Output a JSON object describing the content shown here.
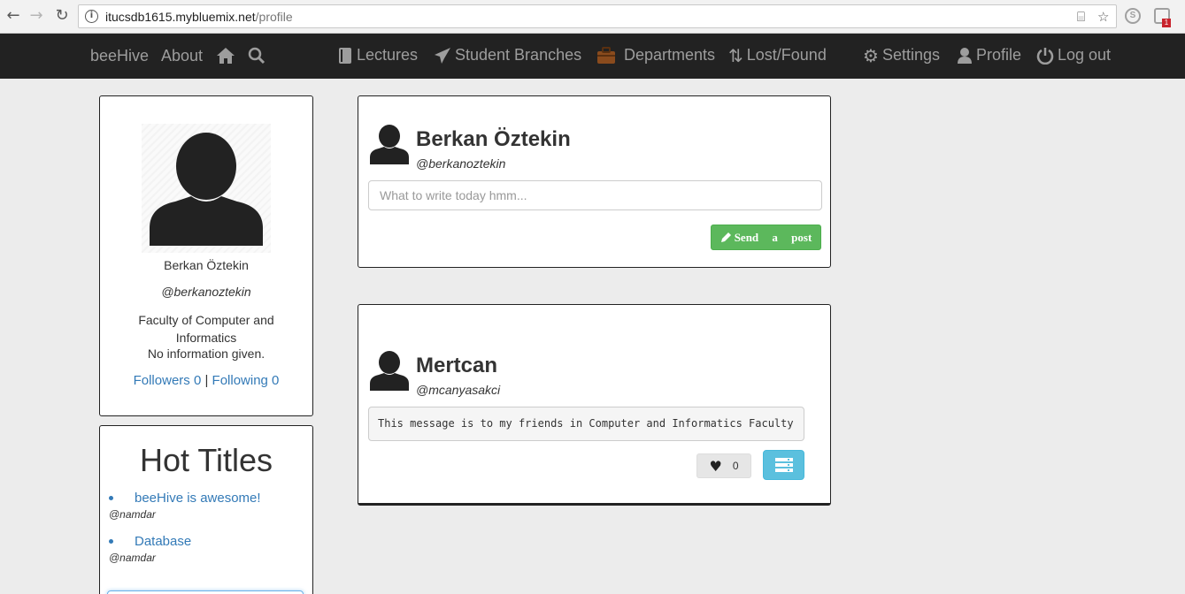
{
  "browser": {
    "url_host": "itucsdb1615.mybluemix.net",
    "url_path": "/profile",
    "extension_badge": "1"
  },
  "navbar": {
    "brand": "beeHive",
    "about": "About",
    "lectures": "Lectures",
    "student_branches": "Student Branches",
    "departments": "Departments",
    "lost_found": "Lost/Found",
    "settings": "Settings",
    "profile": "Profile",
    "logout": "Log out"
  },
  "profile_card": {
    "name": "Berkan Öztekin",
    "handle": "@berkanoztekin",
    "faculty": "Faculty of Computer and Informatics",
    "info": "No information given.",
    "followers_label": "Followers 0",
    "separator": " | ",
    "following_label": "Following 0"
  },
  "hot_titles": {
    "heading": "Hot Titles",
    "items": [
      {
        "title": "beeHive is awesome!",
        "user": "@namdar"
      },
      {
        "title": "Database",
        "user": "@namdar"
      }
    ]
  },
  "compose": {
    "name": "Berkan Öztekin",
    "handle": "@berkanoztekin",
    "placeholder": "What to write today hmm...",
    "send_label": "Send a post"
  },
  "post": {
    "name": "Mertcan",
    "handle": "@mcanyasakci",
    "message": "This message is to my friends in Computer and Informatics Faculty",
    "likes": "0"
  },
  "colors": {
    "navbar_bg": "#222222",
    "link": "#337ab7",
    "send_button": "#5cb85c",
    "list_button": "#5bc0de"
  },
  "icons": [
    "back-arrow-icon",
    "forward-arrow-icon",
    "reload-icon",
    "info-icon",
    "translate-icon",
    "star-icon",
    "skype-icon",
    "extension-icon",
    "home-icon",
    "search-icon",
    "book-icon",
    "paper-plane-icon",
    "briefcase-icon",
    "sort-icon",
    "gear-icon",
    "user-icon",
    "power-icon",
    "pencil-icon",
    "heart-icon",
    "list-icon"
  ]
}
